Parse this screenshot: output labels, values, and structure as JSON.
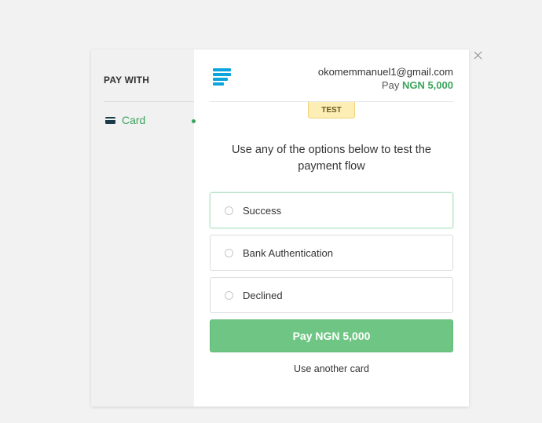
{
  "sidebar": {
    "title": "PAY WITH",
    "items": [
      {
        "label": "Card",
        "icon": "card-icon",
        "active": true
      }
    ]
  },
  "header": {
    "email": "okomemmanuel1@gmail.com",
    "pay_prefix": "Pay",
    "amount": "NGN 5,000"
  },
  "badge": "TEST",
  "instructions": "Use any of the options below to test the payment flow",
  "options": [
    {
      "label": "Success",
      "selected": true
    },
    {
      "label": "Bank Authentication",
      "selected": false
    },
    {
      "label": "Declined",
      "selected": false
    }
  ],
  "pay_button": "Pay NGN 5,000",
  "another_card": "Use another card",
  "colors": {
    "accent_green": "#3aa45a",
    "button_green": "#6fc684",
    "logo_blue": "#0ba4db",
    "badge_yellow": "#fdeeb5"
  },
  "icons": {
    "logo": "stacked-bars-logo-icon",
    "close": "close-icon"
  }
}
